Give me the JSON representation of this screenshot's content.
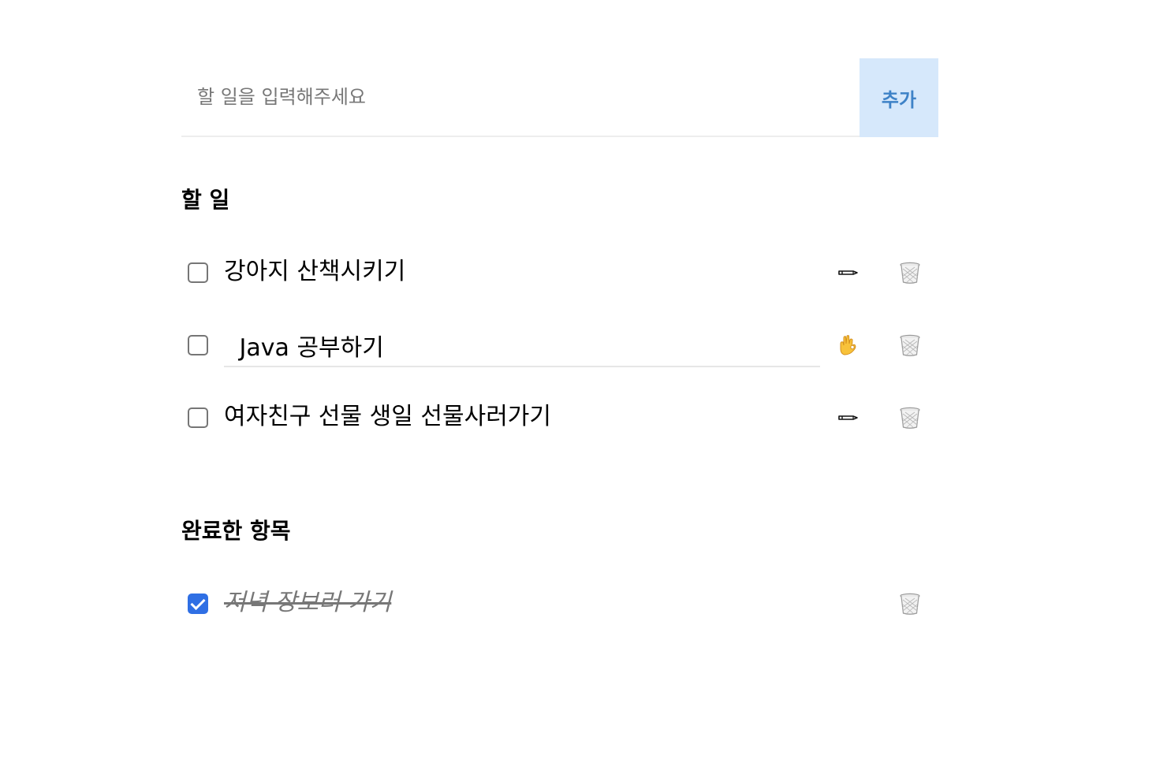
{
  "add_form": {
    "placeholder": "할 일을 입력해주세요",
    "value": "",
    "button_label": "추가"
  },
  "todo_section": {
    "title": "할 일",
    "items": [
      {
        "text": "강아지 산책시키기",
        "checked": false,
        "editing": false,
        "action_icon": "pencil-icon"
      },
      {
        "text": " Java 공부하기",
        "checked": false,
        "editing": true,
        "action_icon": "ok-hand-icon"
      },
      {
        "text": "여자친구 선물 생일 선물사러가기",
        "checked": false,
        "editing": false,
        "action_icon": "pencil-icon"
      }
    ]
  },
  "done_section": {
    "title": "완료한 항목",
    "items": [
      {
        "text": "저녁 장보러 가기",
        "checked": true
      }
    ]
  },
  "colors": {
    "add_button_bg": "#d6e8fb",
    "add_button_text": "#3e82c7",
    "checkbox_checked": "#2f6fe4",
    "done_text": "#777777"
  }
}
